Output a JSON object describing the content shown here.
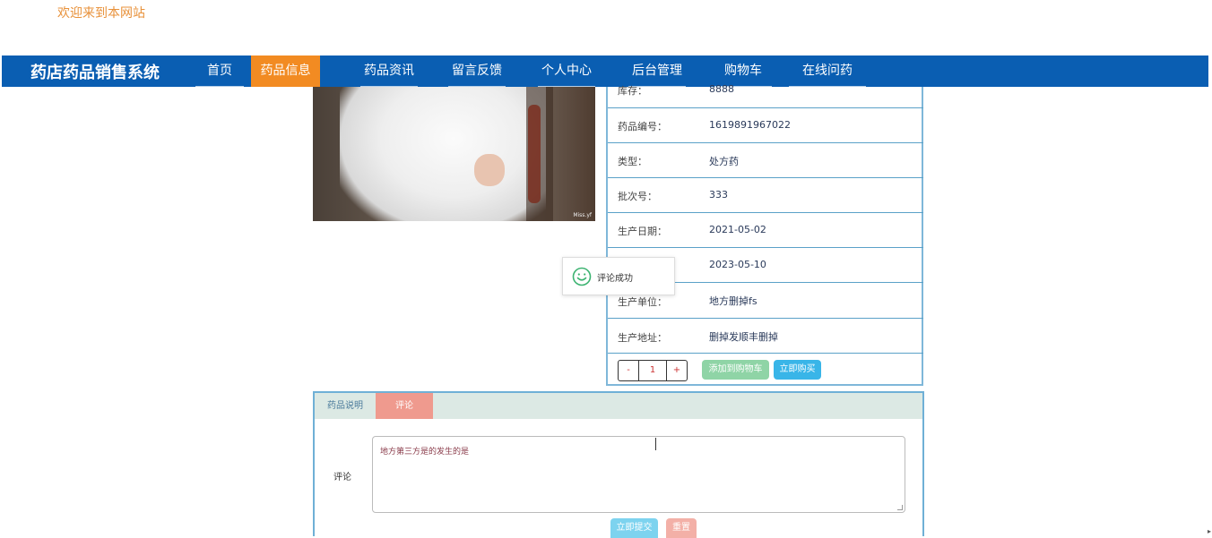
{
  "header": {
    "welcome": "欢迎来到本网站"
  },
  "nav": {
    "brand": "药店药品销售系统",
    "items": [
      {
        "label": "首页",
        "active": false
      },
      {
        "label": "药品信息",
        "active": true
      },
      {
        "label": "药品资讯",
        "active": false
      },
      {
        "label": "留言反馈",
        "active": false
      },
      {
        "label": "个人中心",
        "active": false
      },
      {
        "label": "后台管理",
        "active": false
      },
      {
        "label": "购物车",
        "active": false
      },
      {
        "label": "在线问药",
        "active": false
      }
    ]
  },
  "product": {
    "photo_watermark": "Miss.yf",
    "details": [
      {
        "label": "库存：",
        "value": "8888"
      },
      {
        "label": "药品编号：",
        "value": "1619891967022"
      },
      {
        "label": "类型：",
        "value": "处方药"
      },
      {
        "label": "批次号：",
        "value": "333"
      },
      {
        "label": "生产日期：",
        "value": "2021-05-02"
      },
      {
        "label": "",
        "value": "2023-05-10"
      },
      {
        "label": "生产单位：",
        "value": "地方删掉fs"
      },
      {
        "label": "生产地址：",
        "value": "删掉发顺丰删掉"
      }
    ],
    "quantity": {
      "minus": "-",
      "value": "1",
      "plus": "+"
    },
    "add_to_cart": "添加到购物车",
    "buy_now": "立即购买"
  },
  "toast": {
    "icon": "smile-icon",
    "message": "评论成功",
    "color": "#3cb371"
  },
  "tabs": [
    {
      "label": "药品说明",
      "active": false
    },
    {
      "label": "评论",
      "active": true
    }
  ],
  "comment": {
    "label": "评论",
    "value": "地方第三方是的发生的是",
    "submit": "立即提交",
    "reset": "重置"
  },
  "colors": {
    "nav_bg": "#0a5eb2",
    "nav_active": "#f28b22",
    "welcome": "#e8913a"
  }
}
